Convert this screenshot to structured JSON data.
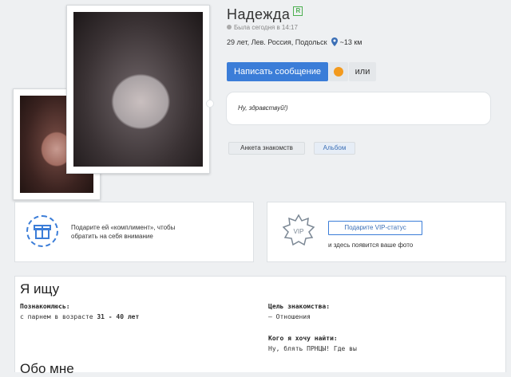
{
  "profile": {
    "name": "Надежда",
    "badge": "R",
    "last_seen": "Была сегодня в 14:17",
    "details": "29 лет, Лев. Россия, Подольск",
    "distance": "~13 км"
  },
  "actions": {
    "message_button": "Написать сообщение",
    "or_label": "или"
  },
  "greeting": {
    "text": "Ну, здравствуй!)"
  },
  "tabs": {
    "questionnaire": "Анкета знакомств",
    "album": "Альбом"
  },
  "promo": {
    "gift_text_line1": "Подарите ей «комплимент», чтобы",
    "gift_text_line2": "обратить на себя внимание",
    "vip_button": "Подарите VIP-статус",
    "vip_caption": "и здесь появится ваше фото",
    "vip_badge": "VIP"
  },
  "looking_for": {
    "title": "Я ищу",
    "meet_label": "Познакомлюсь:",
    "meet_value_prefix": "с парнем в возрасте ",
    "meet_value_bold": "31 - 40 лет",
    "goal_label": "Цель знакомства:",
    "goal_value": "— Отношения",
    "who_label": "Кого я хочу найти:",
    "who_value": "Ну, блять ПРНЦЫ! Где вы"
  },
  "about": {
    "title": "Обо мне"
  },
  "colors": {
    "accent": "#3b7dd8",
    "online_badge": "#4caf50"
  }
}
